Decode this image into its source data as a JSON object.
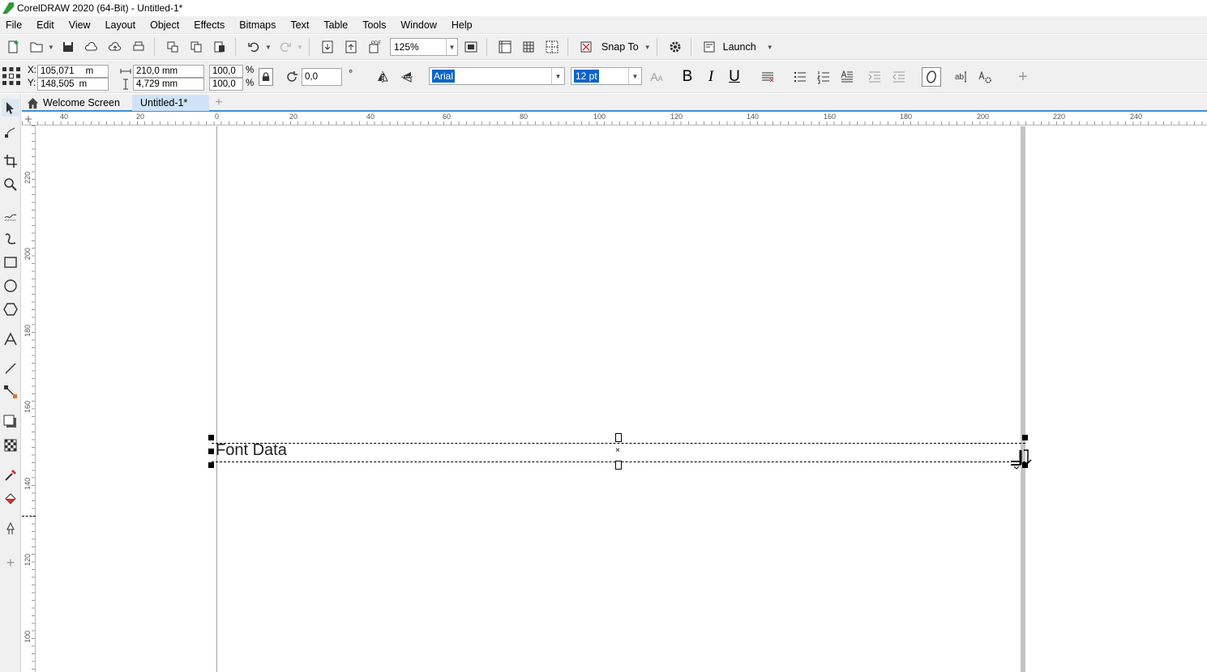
{
  "window": {
    "title": "CorelDRAW 2020 (64-Bit) - Untitled-1*"
  },
  "menu": [
    "File",
    "Edit",
    "View",
    "Layout",
    "Object",
    "Effects",
    "Bitmaps",
    "Text",
    "Table",
    "Tools",
    "Window",
    "Help"
  ],
  "toolbar": {
    "zoom": "125%",
    "snap_label": "Snap To",
    "launch_label": "Launch",
    "pdf_label": "PDF"
  },
  "properties": {
    "x_label": "X:",
    "y_label": "Y:",
    "x_value": "105,071",
    "y_value": "148,505",
    "x_unit": "m",
    "y_unit": "m",
    "width": "210,0 mm",
    "height": "4,729 mm",
    "scale_w": "100,0",
    "scale_h": "100,0",
    "percent": "%",
    "rotation": "0,0",
    "degree": "°",
    "font": "Arial",
    "font_size": "12 pt",
    "bold": "B",
    "italic": "I",
    "underline": "U"
  },
  "tabs": [
    {
      "label": "Welcome Screen"
    },
    {
      "label": "Untitled-1*"
    }
  ],
  "ruler": {
    "horizontal": [
      "40",
      "20",
      "0",
      "20",
      "40",
      "60",
      "80",
      "100",
      "120",
      "140",
      "160",
      "180",
      "200",
      "220",
      "240"
    ],
    "vertical": [
      "220",
      "200",
      "180",
      "160",
      "140",
      "120",
      "100"
    ]
  },
  "document": {
    "text": "Font Data"
  }
}
